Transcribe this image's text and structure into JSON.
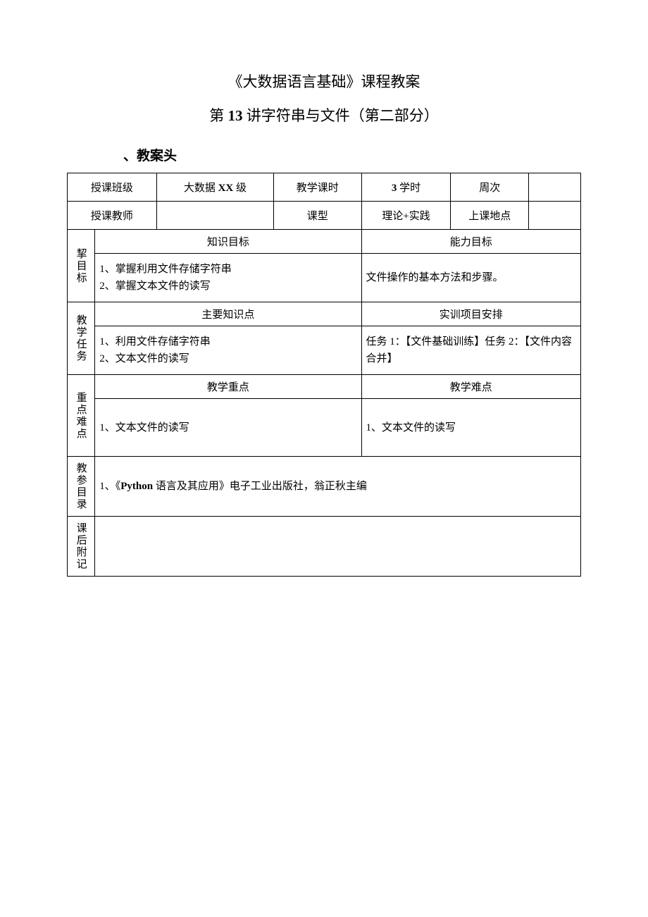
{
  "title": "《大数据语言基础》课程教案",
  "subtitle_prefix": "第 ",
  "subtitle_number": "13",
  "subtitle_suffix": " 讲字符串与文件（第二部分）",
  "section_header": "、教案头",
  "row1": {
    "label_class": "授课班级",
    "value_class_prefix": "大数据 ",
    "value_class_bold": "XX",
    "value_class_suffix": " 级",
    "label_hours": "教学课时",
    "value_hours_bold": "3",
    "value_hours_suffix": " 学时",
    "label_week": "周次",
    "value_week": ""
  },
  "row2": {
    "label_teacher": "授课教师",
    "value_teacher": "",
    "label_type": "课型",
    "value_type": "理论+实践",
    "label_location": "上课地点",
    "value_location": ""
  },
  "objectives": {
    "label": "挈目标",
    "knowledge_header": "知识目标",
    "ability_header": "能力目标",
    "knowledge_content": "1、掌握利用文件存储字符串\n2、掌握文本文件的读写",
    "ability_content": "文件操作的基本方法和步骤。"
  },
  "tasks": {
    "label": "教学任务",
    "knowledge_header": "主要知识点",
    "training_header": "实训项目安排",
    "knowledge_content": "1、利用文件存储字符串\n2、文本文件的读写",
    "training_content": "任务 1：【文件基础训练】任务 2：【文件内容合并】"
  },
  "keypoints": {
    "label": "重点难点",
    "focus_header": "教学重点",
    "difficulty_header": "教学难点",
    "focus_content": "1、文本文件的读写",
    "difficulty_content": "1、文本文件的读写"
  },
  "references": {
    "label": "教参目录",
    "content_prefix": "1、《",
    "content_bold": "Python",
    "content_suffix": " 语言及其应用》电子工业出版社，翁正秋主编"
  },
  "notes": {
    "label": "课后附记",
    "content": ""
  }
}
